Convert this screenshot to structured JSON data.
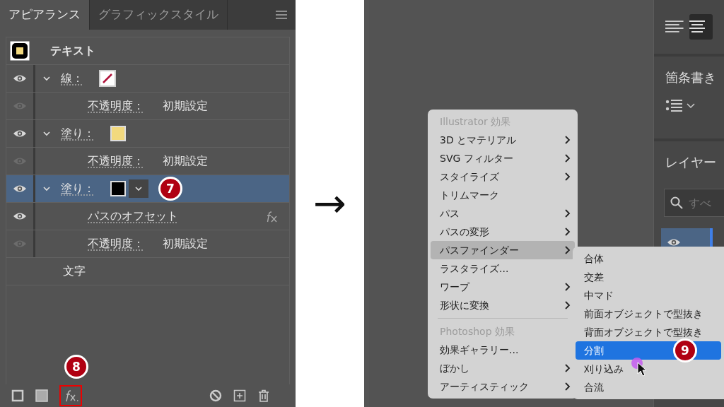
{
  "appearance_panel": {
    "tabs": [
      {
        "label": "アピアランス",
        "selected": true
      },
      {
        "label": "グラフィックスタイル",
        "selected": false
      }
    ],
    "header": {
      "label": "テキスト"
    },
    "rows": [
      {
        "kind": "attribute",
        "label": "線：",
        "visible": true,
        "expanded": true,
        "selected": false,
        "swatch": {
          "kind": "none"
        },
        "children": [
          {
            "kind": "opacity",
            "label": "不透明度：",
            "value": "初期設定",
            "visible": false
          }
        ]
      },
      {
        "kind": "attribute",
        "label": "塗り：",
        "visible": true,
        "expanded": true,
        "selected": false,
        "swatch": {
          "kind": "color",
          "color": "#f2d97e"
        },
        "children": [
          {
            "kind": "opacity",
            "label": "不透明度：",
            "value": "初期設定",
            "visible": false
          }
        ]
      },
      {
        "kind": "attribute",
        "label": "塗り：",
        "visible": true,
        "expanded": true,
        "selected": true,
        "dropdown": true,
        "badge": "7",
        "swatch": {
          "kind": "color",
          "color": "#000000"
        },
        "children": [
          {
            "kind": "effect",
            "label": "パスのオフセット",
            "visible": true
          },
          {
            "kind": "opacity",
            "label": "不透明度：",
            "value": "初期設定",
            "visible": false
          }
        ]
      },
      {
        "kind": "characters",
        "label": "文字"
      }
    ],
    "footer": {
      "fx_highlighted": true,
      "badge": "8"
    }
  },
  "arrow": "→",
  "side_panel": {
    "bullets_title": "箇条書き",
    "layers_title": "レイヤー",
    "search_placeholder": "すべ"
  },
  "effect_menu": {
    "items": [
      {
        "kind": "heading",
        "label": "Illustrator 効果"
      },
      {
        "kind": "item",
        "label": "3D とマテリアル",
        "submenu": true,
        "selected": false
      },
      {
        "kind": "item",
        "label": "SVG フィルター",
        "submenu": true,
        "selected": false
      },
      {
        "kind": "item",
        "label": "スタイライズ",
        "submenu": true,
        "selected": false
      },
      {
        "kind": "item",
        "label": "トリムマーク",
        "submenu": false,
        "selected": false
      },
      {
        "kind": "item",
        "label": "パス",
        "submenu": true,
        "selected": false
      },
      {
        "kind": "item",
        "label": "パスの変形",
        "submenu": true,
        "selected": false
      },
      {
        "kind": "item",
        "label": "パスファインダー",
        "submenu": true,
        "selected": true
      },
      {
        "kind": "item",
        "label": "ラスタライズ...",
        "submenu": false,
        "selected": false
      },
      {
        "kind": "item",
        "label": "ワープ",
        "submenu": true,
        "selected": false
      },
      {
        "kind": "item",
        "label": "形状に変換",
        "submenu": true,
        "selected": false
      },
      {
        "kind": "separator"
      },
      {
        "kind": "heading",
        "label": "Photoshop 効果"
      },
      {
        "kind": "item",
        "label": "効果ギャラリー...",
        "submenu": false,
        "selected": false
      },
      {
        "kind": "item",
        "label": "ぼかし",
        "submenu": true,
        "selected": false
      },
      {
        "kind": "item",
        "label": "アーティスティック",
        "submenu": true,
        "selected": false
      }
    ],
    "submenu": {
      "items": [
        {
          "label": "合体",
          "selected": false
        },
        {
          "label": "交差",
          "selected": false
        },
        {
          "label": "中マド",
          "selected": false
        },
        {
          "label": "前面オブジェクトで型抜き",
          "selected": false
        },
        {
          "label": "背面オブジェクトで型抜き",
          "selected": false
        },
        {
          "label": "分割",
          "selected": true,
          "badge": "9"
        },
        {
          "label": "刈り込み",
          "selected": false
        },
        {
          "label": "合流",
          "selected": false
        }
      ]
    }
  }
}
